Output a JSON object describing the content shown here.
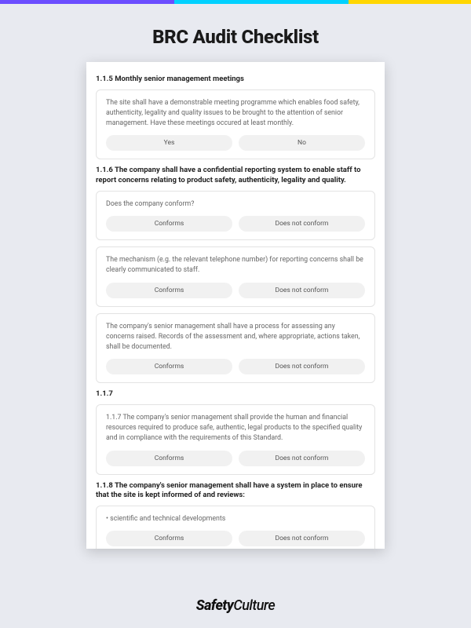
{
  "page_title": "BRC Audit Checklist",
  "brand": {
    "part1": "Safety",
    "part2": "Culture"
  },
  "sections": [
    {
      "heading": "1.1.5 Monthly senior management meetings",
      "cards": [
        {
          "text": "The site shall have a demonstrable meeting programme which enables food safety, authenticity, legality and quality issues to be brought to the attention of senior management. Have these meetings occured at least monthly.",
          "options": [
            "Yes",
            "No"
          ]
        }
      ]
    },
    {
      "heading": "1.1.6 The company shall have a confidential reporting system to enable staff to report concerns relating to product safety, authenticity, legality and quality.",
      "cards": [
        {
          "text": "Does the company conform?",
          "options": [
            "Conforms",
            "Does not conform"
          ]
        },
        {
          "text": "The mechanism (e.g. the relevant telephone number) for reporting concerns shall be clearly communicated to staff.",
          "options": [
            "Conforms",
            "Does not conform"
          ]
        },
        {
          "text": "The company's senior management shall have a process for assessing any concerns raised. Records of the assessment and, where appropriate, actions taken, shall be documented.",
          "options": [
            "Conforms",
            "Does not conform"
          ]
        }
      ]
    },
    {
      "heading": "1.1.7",
      "cards": [
        {
          "text": "1.1.7 The company's senior management shall provide the human and financial resources required to produce safe, authentic, legal products to the specified quality and in compliance with the requirements of this Standard.",
          "options": [
            "Conforms",
            "Does not conform"
          ]
        }
      ]
    },
    {
      "heading": "1.1.8 The company's senior management shall have a system in place to ensure that the site is kept informed of and reviews:",
      "cards": [
        {
          "text": "• scientific and technical developments",
          "options": [
            "Conforms",
            "Does not conform"
          ]
        }
      ]
    }
  ]
}
